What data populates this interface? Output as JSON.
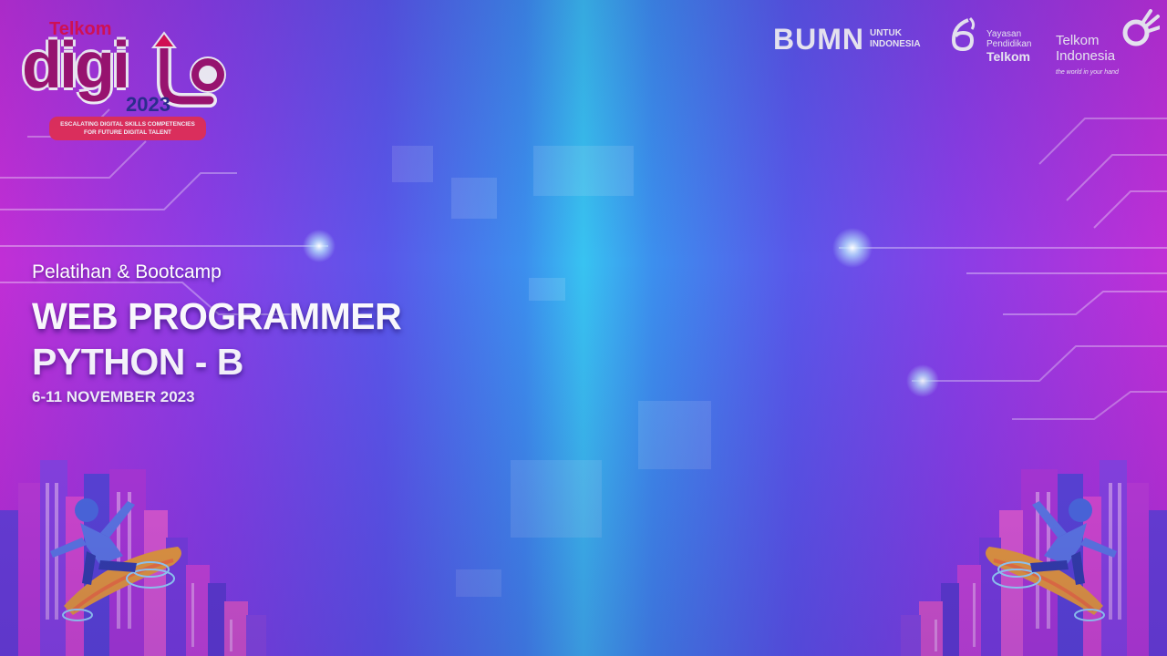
{
  "logo": {
    "brand": "Telkom",
    "name": "digi",
    "year": "2023",
    "tagline_line1": "ESCALATING DIGITAL SKILLS COMPETENCIES",
    "tagline_line2": "FOR FUTURE DIGITAL TALENT"
  },
  "partners": {
    "bumn": {
      "mark": "BUMN",
      "sub_line1": "UNTUK",
      "sub_line2": "INDONESIA"
    },
    "yayasan": {
      "line1": "Yayasan",
      "line2": "Pendidikan",
      "brand": "Telkom"
    },
    "telkom_indonesia": {
      "line1": "Telkom",
      "line2": "Indonesia",
      "tagline": "the world in your hand"
    }
  },
  "event": {
    "kicker": "Pelatihan & Bootcamp",
    "title_line1": "WEB PROGRAMMER",
    "title_line2": "PYTHON - B",
    "date": "6-11 NOVEMBER 2023"
  },
  "colors": {
    "magenta": "#c12fd6",
    "cyan": "#38c3f1",
    "logo_red": "#e8104f",
    "logo_purple": "#a4136e",
    "logo_navy": "#2b2f8f"
  }
}
